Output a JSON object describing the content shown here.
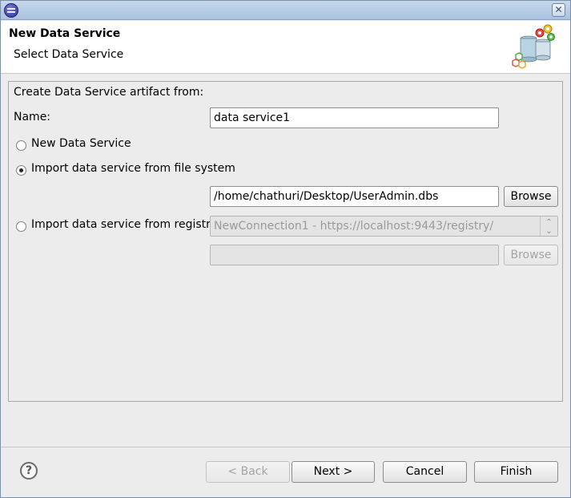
{
  "titlebar": {
    "close_icon": "✕"
  },
  "header": {
    "title": "New Data Service",
    "subtitle": "Select Data Service"
  },
  "form": {
    "section_label": "Create Data Service artifact from:",
    "name_label": "Name:",
    "name_value": "data service1",
    "options": {
      "new": "New Data Service",
      "import_fs": "Import data service from file system",
      "import_registry": "Import data service from registry"
    },
    "selected_option": "import_fs",
    "file_path_value": "/home/chathuri/Desktop/UserAdmin.dbs",
    "browse_label": "Browse",
    "registry_connection_value": "NewConnection1 - https://localhost:9443/registry/",
    "registry_path_value": "",
    "registry_browse_label": "Browse"
  },
  "footer": {
    "help_icon": "?",
    "back_label": "< Back",
    "next_label": "Next >",
    "cancel_label": "Cancel",
    "finish_label": "Finish"
  }
}
